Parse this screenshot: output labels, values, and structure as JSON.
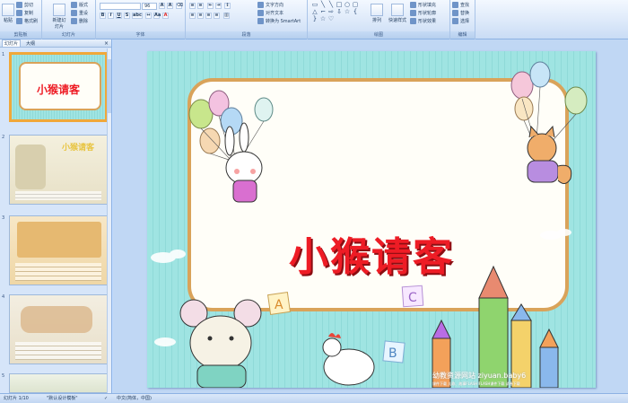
{
  "ribbon": {
    "clipboard": {
      "label": "剪贴板",
      "paste": "粘贴",
      "cut": "剪切",
      "copy": "复制",
      "format_painter": "格式刷"
    },
    "slides": {
      "label": "幻灯片",
      "new_slide": "新建幻灯片",
      "layout": "版式",
      "reset": "重设",
      "delete": "删除"
    },
    "font": {
      "label": "字体",
      "font_size": "96",
      "bold": "B",
      "italic": "I",
      "underline": "U",
      "strike": "S",
      "shadow": "abc",
      "font_color": "A"
    },
    "paragraph": {
      "label": "段落",
      "text_direction": "文字方向",
      "align_text": "对齐文本",
      "smartart": "转换为 SmartArt"
    },
    "drawing": {
      "label": "绘图",
      "arrange": "排列",
      "quick_styles": "快速样式",
      "shape_fill": "形状填充",
      "shape_outline": "形状轮廓",
      "shape_effects": "形状效果"
    },
    "editing": {
      "label": "编辑",
      "find": "查找",
      "replace": "替换",
      "select": "选择"
    }
  },
  "left_panel": {
    "tab_slides": "幻灯片",
    "tab_outline": "大纲",
    "close": "×",
    "thumbnails": [
      {
        "number": "1",
        "title": "小猴请客",
        "selected": true
      },
      {
        "number": "2",
        "title": "小猴请客",
        "caption": ""
      },
      {
        "number": "3",
        "title": ""
      },
      {
        "number": "4",
        "title": ""
      },
      {
        "number": "5",
        "title": ""
      }
    ]
  },
  "slide": {
    "title": "小猴请客",
    "watermark": "幼教资源网站 ziyuan.baby6",
    "watermark_sub": "课件下载    儿歌、故事FLASH    FLASH课件下载    试卷下载  "
  },
  "statusbar": {
    "slide_info": "幻灯片 1/10",
    "theme": "\"默认设计模板\"",
    "language": "中文(简体，中国)"
  },
  "colors": {
    "title_red": "#ee1c25",
    "selection_orange": "#f0a83a",
    "ribbon_blue": "#dbe8f9"
  }
}
